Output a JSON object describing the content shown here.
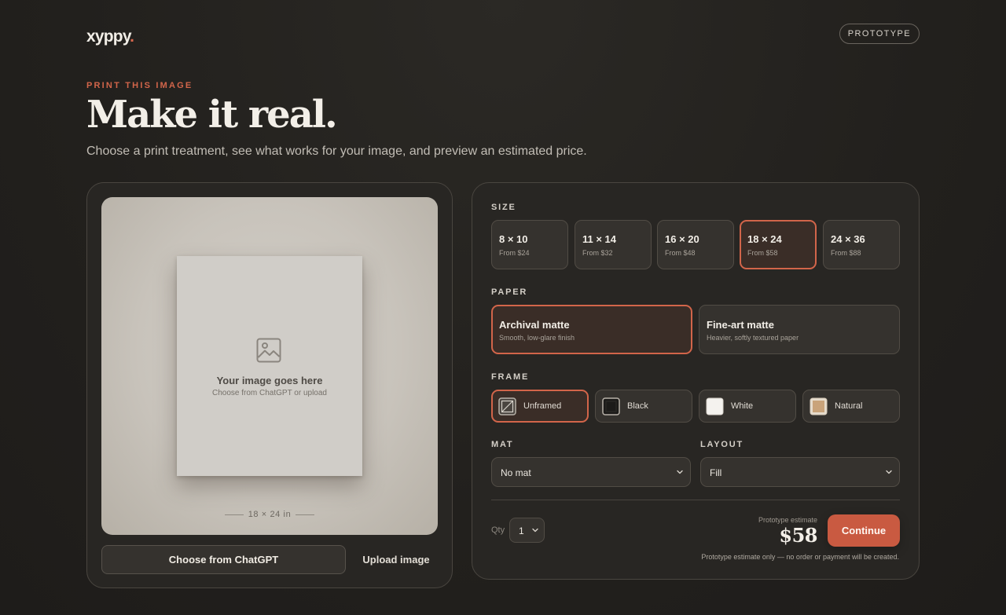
{
  "header": {
    "logo_text": "xyppy",
    "logo_dot": ".",
    "badge": "PROTOTYPE"
  },
  "hero": {
    "eyebrow": "PRINT THIS IMAGE",
    "title": "Make it real.",
    "subtitle": "Choose a print treatment, see what works for your image, and preview an estimated price."
  },
  "preview": {
    "placeholder_title": "Your image goes here",
    "placeholder_sub": "Choose from ChatGPT or upload",
    "dimension_label": "18 × 24 in",
    "choose_button": "Choose from ChatGPT",
    "upload_button": "Upload image"
  },
  "options": {
    "size": {
      "label": "SIZE",
      "selected": "18 × 24",
      "items": [
        {
          "value": "8 × 10",
          "price": "From $24"
        },
        {
          "value": "11 × 14",
          "price": "From $32"
        },
        {
          "value": "16 × 20",
          "price": "From $48"
        },
        {
          "value": "18 × 24",
          "price": "From $58"
        },
        {
          "value": "24 × 36",
          "price": "From $88"
        }
      ]
    },
    "paper": {
      "label": "PAPER",
      "selected": "Archival matte",
      "items": [
        {
          "name": "Archival matte",
          "desc": "Smooth, low-glare finish"
        },
        {
          "name": "Fine-art matte",
          "desc": "Heavier, softly textured paper"
        }
      ]
    },
    "frame": {
      "label": "FRAME",
      "selected": "Unframed",
      "items": [
        {
          "name": "Unframed",
          "icon": "unframed-swatch"
        },
        {
          "name": "Black",
          "color": "#1c1b19"
        },
        {
          "name": "White",
          "color": "#f4f2ee"
        },
        {
          "name": "Natural",
          "color": "#c9a37a"
        }
      ]
    },
    "mat": {
      "label": "MAT",
      "value": "No mat"
    },
    "layout": {
      "label": "LAYOUT",
      "value": "Fill"
    }
  },
  "footer": {
    "qty_label": "Qty",
    "qty_value": "1",
    "estimate_label": "Prototype estimate",
    "estimate_price": "$58",
    "continue_button": "Continue",
    "disclaimer": "Prototype estimate only — no order or payment will be created."
  },
  "colors": {
    "accent": "#d2654a",
    "button": "#c95a41",
    "background": "#22201d",
    "card": "#282623"
  }
}
